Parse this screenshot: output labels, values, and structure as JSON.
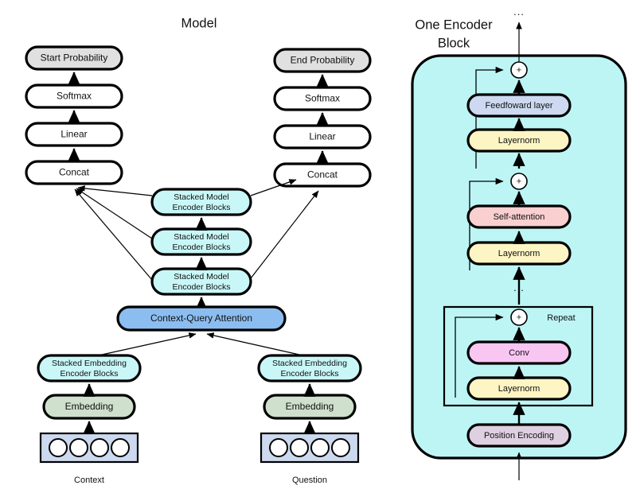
{
  "titles": {
    "left": "Model",
    "right_line1": "One Encoder",
    "right_line2": "Block"
  },
  "left_panel": {
    "start_column": {
      "boxes": [
        {
          "label": "Start Probability",
          "color": "#e0e0e0",
          "name": "start-probability-box"
        },
        {
          "label": "Softmax",
          "color": "#ffffff",
          "name": "softmax-box-left"
        },
        {
          "label": "Linear",
          "color": "#ffffff",
          "name": "linear-box-left"
        },
        {
          "label": "Concat",
          "color": "#ffffff",
          "name": "concat-box-left"
        }
      ]
    },
    "end_column": {
      "boxes": [
        {
          "label": "End Probability",
          "color": "#e0e0e0",
          "name": "end-probability-box"
        },
        {
          "label": "Softmax",
          "color": "#ffffff",
          "name": "softmax-box-right"
        },
        {
          "label": "Linear",
          "color": "#ffffff",
          "name": "linear-box-right"
        },
        {
          "label": "Concat",
          "color": "#ffffff",
          "name": "concat-box-right"
        }
      ]
    },
    "model_encoders": [
      {
        "line1": "Stacked Model",
        "line2": "Encoder Blocks",
        "color": "#c9f7f7"
      },
      {
        "line1": "Stacked Model",
        "line2": "Encoder Blocks",
        "color": "#c9f7f7"
      },
      {
        "line1": "Stacked Model",
        "line2": "Encoder Blocks",
        "color": "#c9f7f7"
      }
    ],
    "attention": {
      "label": "Context-Query Attention",
      "color": "#8cbdf0"
    },
    "context_branch": {
      "encoder_line1": "Stacked Embedding",
      "encoder_line2": "Encoder Blocks",
      "encoder_color": "#c9f7f7",
      "embedding_label": "Embedding",
      "embedding_color": "#cfe0cd",
      "tokens_color": "#ccd9ef",
      "token_count": 4,
      "caption": "Context"
    },
    "question_branch": {
      "encoder_line1": "Stacked Embedding",
      "encoder_line2": "Encoder Blocks",
      "encoder_color": "#c9f7f7",
      "embedding_label": "Embedding",
      "embedding_color": "#cfe0cd",
      "tokens_color": "#ccd9ef",
      "token_count": 4,
      "caption": "Question"
    }
  },
  "right_panel": {
    "panel_color": "#bdf5f5",
    "top_dots": "...",
    "mid_dots": "...",
    "repeat_label": "Repeat",
    "plus_symbol": "+",
    "blocks": [
      {
        "label": "Feedfoward layer",
        "color": "#ccd9f0",
        "name": "feedforward-layer-box"
      },
      {
        "label": "Layernorm",
        "color": "#fdf5c4",
        "name": "layernorm-box-3"
      },
      {
        "label": "Self-attention",
        "color": "#f9cfcf",
        "name": "self-attention-box"
      },
      {
        "label": "Layernorm",
        "color": "#fdf5c4",
        "name": "layernorm-box-2"
      },
      {
        "label": "Conv",
        "color": "#f9c6f2",
        "name": "conv-box"
      },
      {
        "label": "Layernorm",
        "color": "#fdf5c4",
        "name": "layernorm-box-1"
      },
      {
        "label": "Position Encoding",
        "color": "#ded0e0",
        "name": "position-encoding-box"
      }
    ]
  }
}
